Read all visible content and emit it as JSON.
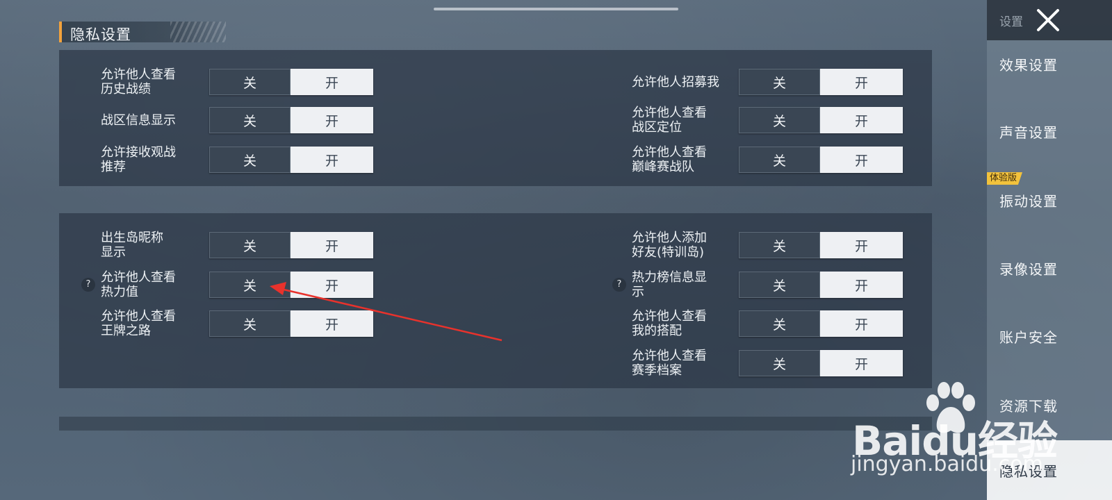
{
  "section": {
    "title": "隐私设置"
  },
  "toggle_labels": {
    "off": "关",
    "on": "开"
  },
  "help_glyph": "?",
  "panel1": {
    "left": [
      {
        "label": "允许他人查看\n历史战绩",
        "state": "on"
      },
      {
        "label": "战区信息显示",
        "state": "on"
      },
      {
        "label": "允许接收观战\n推荐",
        "state": "on"
      }
    ],
    "right": [
      {
        "label": "允许他人招募我",
        "state": "on"
      },
      {
        "label": "允许他人查看\n战区定位",
        "state": "on"
      },
      {
        "label": "允许他人查看\n巅峰赛战队",
        "state": "on"
      }
    ]
  },
  "panel2": {
    "left": [
      {
        "label": "出生岛昵称\n显示",
        "state": "on"
      },
      {
        "label": "允许他人查看\n热力值",
        "state": "on",
        "help": true
      },
      {
        "label": "允许他人查看\n王牌之路",
        "state": "on"
      }
    ],
    "right": [
      {
        "label": "允许他人添加\n好友(特训岛)",
        "state": "on"
      },
      {
        "label": "热力榜信息显\n示",
        "state": "on",
        "help": true
      },
      {
        "label": "允许他人查看\n我的搭配",
        "state": "on"
      },
      {
        "label": "允许他人查看\n赛季档案",
        "state": "on"
      }
    ]
  },
  "sidebar": {
    "title": "设置",
    "badge": "体验版",
    "items": [
      {
        "label": "效果设置"
      },
      {
        "label": "声音设置"
      },
      {
        "label": "振动设置"
      },
      {
        "label": "录像设置"
      },
      {
        "label": "账户安全"
      },
      {
        "label": "资源下载"
      },
      {
        "label": "隐私设置",
        "active": true
      }
    ]
  },
  "watermark": {
    "brand": "Baidu经验",
    "url": "jingyan.baidu.com"
  },
  "colors": {
    "accent": "#f2a23c",
    "badge": "#f2c23c",
    "arrow": "#e8322c"
  }
}
